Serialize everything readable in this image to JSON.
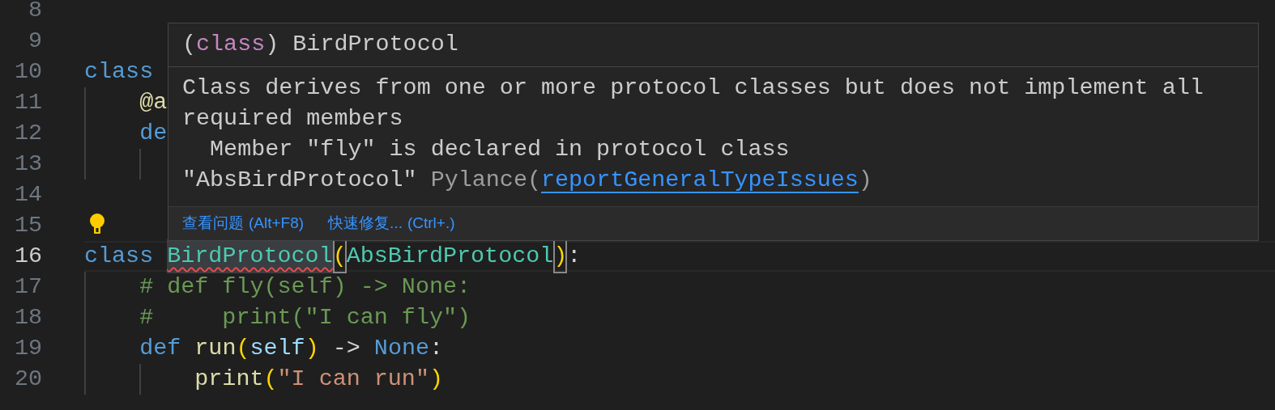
{
  "editor": {
    "lines": [
      {
        "number": "8",
        "kind": "code",
        "current": false,
        "lightbulb": false
      },
      {
        "number": "9",
        "kind": "code",
        "current": false,
        "lightbulb": false
      },
      {
        "number": "10",
        "kind": "code",
        "current": false,
        "lightbulb": false,
        "tokens": [
          {
            "text": "class",
            "kind": "keyword"
          }
        ]
      },
      {
        "number": "11",
        "kind": "code",
        "current": false,
        "lightbulb": false,
        "tokens": [
          {
            "text": "    @a",
            "kind": "decorator"
          }
        ]
      },
      {
        "number": "12",
        "kind": "code",
        "current": false,
        "lightbulb": false,
        "tokens": [
          {
            "text": "    de",
            "kind": "keyword"
          }
        ]
      },
      {
        "number": "13",
        "kind": "indented-blank",
        "current": false,
        "lightbulb": false
      },
      {
        "number": "14",
        "kind": "code",
        "current": false,
        "lightbulb": false
      },
      {
        "number": "15",
        "kind": "code",
        "current": false,
        "lightbulb": true
      },
      {
        "number": "16",
        "kind": "code",
        "current": true,
        "lightbulb": false,
        "tokens": [
          {
            "text": "class ",
            "kind": "keyword"
          },
          {
            "text": "BirdProtocol",
            "kind": "class",
            "error": true
          },
          {
            "text": "(",
            "kind": "bracket",
            "matched": true
          },
          {
            "text": "AbsBirdProtocol",
            "kind": "class"
          },
          {
            "text": ")",
            "kind": "bracket",
            "matched": true
          },
          {
            "text": ":",
            "kind": "plain"
          }
        ]
      },
      {
        "number": "17",
        "kind": "code",
        "current": false,
        "lightbulb": false,
        "tokens": [
          {
            "text": "    # def fly(self) -> None:",
            "kind": "comment"
          }
        ]
      },
      {
        "number": "18",
        "kind": "code",
        "current": false,
        "lightbulb": false,
        "tokens": [
          {
            "text": "    #     print(\"I can fly\")",
            "kind": "comment"
          }
        ]
      },
      {
        "number": "19",
        "kind": "code",
        "current": false,
        "lightbulb": false,
        "tokens": [
          {
            "text": "    def ",
            "kind": "keyword"
          },
          {
            "text": "run",
            "kind": "function"
          },
          {
            "text": "(",
            "kind": "bracket"
          },
          {
            "text": "self",
            "kind": "param"
          },
          {
            "text": ")",
            "kind": "bracket"
          },
          {
            "text": " -> ",
            "kind": "plain"
          },
          {
            "text": "None",
            "kind": "keyword"
          },
          {
            "text": ":",
            "kind": "plain"
          }
        ]
      },
      {
        "number": "20",
        "kind": "code",
        "current": false,
        "lightbulb": false,
        "tokens": [
          {
            "text": "        print",
            "kind": "function"
          },
          {
            "text": "(",
            "kind": "bracket"
          },
          {
            "text": "\"I can run\"",
            "kind": "string"
          },
          {
            "text": ")",
            "kind": "bracket"
          }
        ]
      }
    ]
  },
  "hover": {
    "header": [
      {
        "text": "(",
        "kind": "plain"
      },
      {
        "text": "class",
        "kind": "keyword"
      },
      {
        "text": ") BirdProtocol",
        "kind": "plain"
      }
    ],
    "message_lines": [
      "Class derives from one or more protocol classes but does not implement all",
      "required members",
      "  Member \"fly\" is declared in protocol class",
      "\"AbsBirdProtocol\""
    ],
    "source": "Pylance(",
    "code_link": "reportGeneralTypeIssues",
    "source_end": ")",
    "actions": [
      {
        "label": "查看问题",
        "shortcut": "(Alt+F8)"
      },
      {
        "label": "快速修复...",
        "shortcut": "(Ctrl+.)"
      }
    ]
  }
}
